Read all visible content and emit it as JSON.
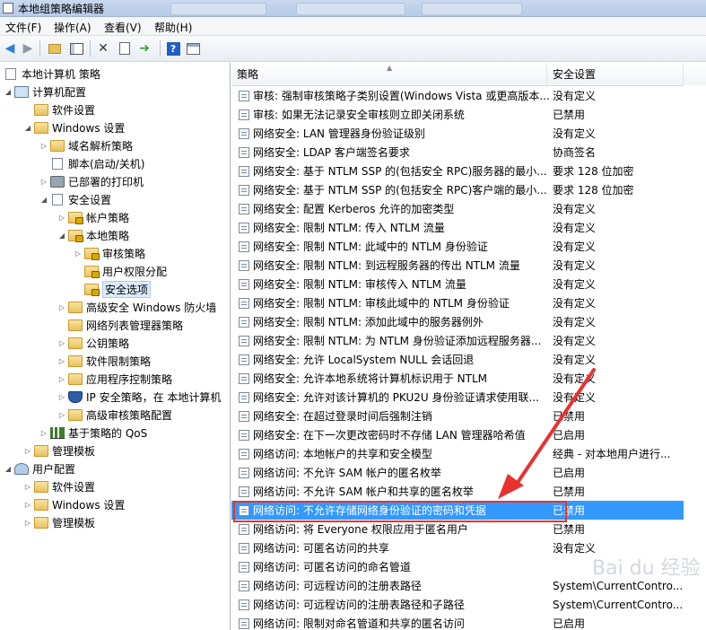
{
  "window": {
    "title": "本地组策略编辑器"
  },
  "menu": [
    {
      "label": "文件(F)"
    },
    {
      "label": "操作(A)"
    },
    {
      "label": "查看(V)"
    },
    {
      "label": "帮助(H)"
    }
  ],
  "toolbar": {
    "icons": [
      "back-arrow-icon",
      "forward-arrow-icon",
      "folder-up-icon",
      "show-hide-tree-icon",
      "delete-icon",
      "properties-icon",
      "export-icon",
      "help-icon",
      "view-icon"
    ]
  },
  "tree": {
    "root": "本地计算机 策略",
    "computer_config": "计算机配置",
    "software_settings": "软件设置",
    "windows_settings": "Windows 设置",
    "name_resolution": "域名解析策略",
    "scripts": "脚本(启动/关机)",
    "deployed_printers": "已部署的打印机",
    "security_settings": "安全设置",
    "account_policies": "帐户策略",
    "local_policies": "本地策略",
    "audit_policy": "审核策略",
    "user_rights": "用户权限分配",
    "security_options": "安全选项",
    "firewall": "高级安全 Windows 防火墙",
    "network_list": "网络列表管理器策略",
    "public_key": "公钥策略",
    "software_restriction": "软件限制策略",
    "app_control": "应用程序控制策略",
    "ipsec": "IP 安全策略，在 本地计算机",
    "advanced_audit": "高级审核策略配置",
    "qos": "基于策略的 QoS",
    "admin_templates": "管理模板",
    "user_config": "用户配置",
    "user_software": "软件设置",
    "user_windows": "Windows 设置",
    "user_admin_templates": "管理模板"
  },
  "list": {
    "columns": {
      "policy": "策略",
      "setting": "安全设置"
    },
    "rows": [
      {
        "policy": "审核: 强制审核策略子类别设置(Windows Vista 或更高版本...",
        "setting": "没有定义"
      },
      {
        "policy": "审核: 如果无法记录安全审核则立即关闭系统",
        "setting": "已禁用"
      },
      {
        "policy": "网络安全: LAN 管理器身份验证级别",
        "setting": "没有定义"
      },
      {
        "policy": "网络安全: LDAP 客户端签名要求",
        "setting": "协商签名"
      },
      {
        "policy": "网络安全: 基于 NTLM SSP 的(包括安全 RPC)服务器的最小...",
        "setting": "要求 128 位加密"
      },
      {
        "policy": "网络安全: 基于 NTLM SSP 的(包括安全 RPC)客户端的最小...",
        "setting": "要求 128 位加密"
      },
      {
        "policy": "网络安全: 配置 Kerberos 允许的加密类型",
        "setting": "没有定义"
      },
      {
        "policy": "网络安全: 限制 NTLM: 传入 NTLM 流量",
        "setting": "没有定义"
      },
      {
        "policy": "网络安全: 限制 NTLM: 此域中的 NTLM 身份验证",
        "setting": "没有定义"
      },
      {
        "policy": "网络安全: 限制 NTLM: 到远程服务器的传出 NTLM 流量",
        "setting": "没有定义"
      },
      {
        "policy": "网络安全: 限制 NTLM: 审核传入 NTLM 流量",
        "setting": "没有定义"
      },
      {
        "policy": "网络安全: 限制 NTLM: 审核此域中的 NTLM 身份验证",
        "setting": "没有定义"
      },
      {
        "policy": "网络安全: 限制 NTLM: 添加此域中的服务器例外",
        "setting": "没有定义"
      },
      {
        "policy": "网络安全: 限制 NTLM: 为 NTLM 身份验证添加远程服务器...",
        "setting": "没有定义"
      },
      {
        "policy": "网络安全: 允许 LocalSystem NULL 会话回退",
        "setting": "没有定义"
      },
      {
        "policy": "网络安全: 允许本地系统将计算机标识用于 NTLM",
        "setting": "没有定义"
      },
      {
        "policy": "网络安全: 允许对该计算机的 PKU2U 身份验证请求使用联...",
        "setting": "没有定义"
      },
      {
        "policy": "网络安全: 在超过登录时间后强制注销",
        "setting": "已禁用"
      },
      {
        "policy": "网络安全: 在下一次更改密码时不存储 LAN 管理器哈希值",
        "setting": "已启用"
      },
      {
        "policy": "网络访问: 本地帐户的共享和安全模型",
        "setting": "经典 - 对本地用户进行..."
      },
      {
        "policy": "网络访问: 不允许 SAM 帐户的匿名枚举",
        "setting": "已启用"
      },
      {
        "policy": "网络访问: 不允许 SAM 帐户和共享的匿名枚举",
        "setting": "已禁用"
      },
      {
        "policy": "网络访问: 不允许存储网络身份验证的密码和凭据",
        "setting": "已禁用"
      },
      {
        "policy": "网络访问: 将 Everyone 权限应用于匿名用户",
        "setting": "已禁用"
      },
      {
        "policy": "网络访问: 可匿名访问的共享",
        "setting": "没有定义"
      },
      {
        "policy": "网络访问: 可匿名访问的命名管道",
        "setting": ""
      },
      {
        "policy": "网络访问: 可远程访问的注册表路径",
        "setting": "System\\CurrentContro..."
      },
      {
        "policy": "网络访问: 可远程访问的注册表路径和子路径",
        "setting": "System\\CurrentContro..."
      },
      {
        "policy": "网络访问: 限制对命名管道和共享的匿名访问",
        "setting": "已启用"
      }
    ],
    "selected_index": 22
  },
  "watermark": "Bai du 经验",
  "colors": {
    "selection": "#3399ff",
    "callout": "#e8322f"
  }
}
